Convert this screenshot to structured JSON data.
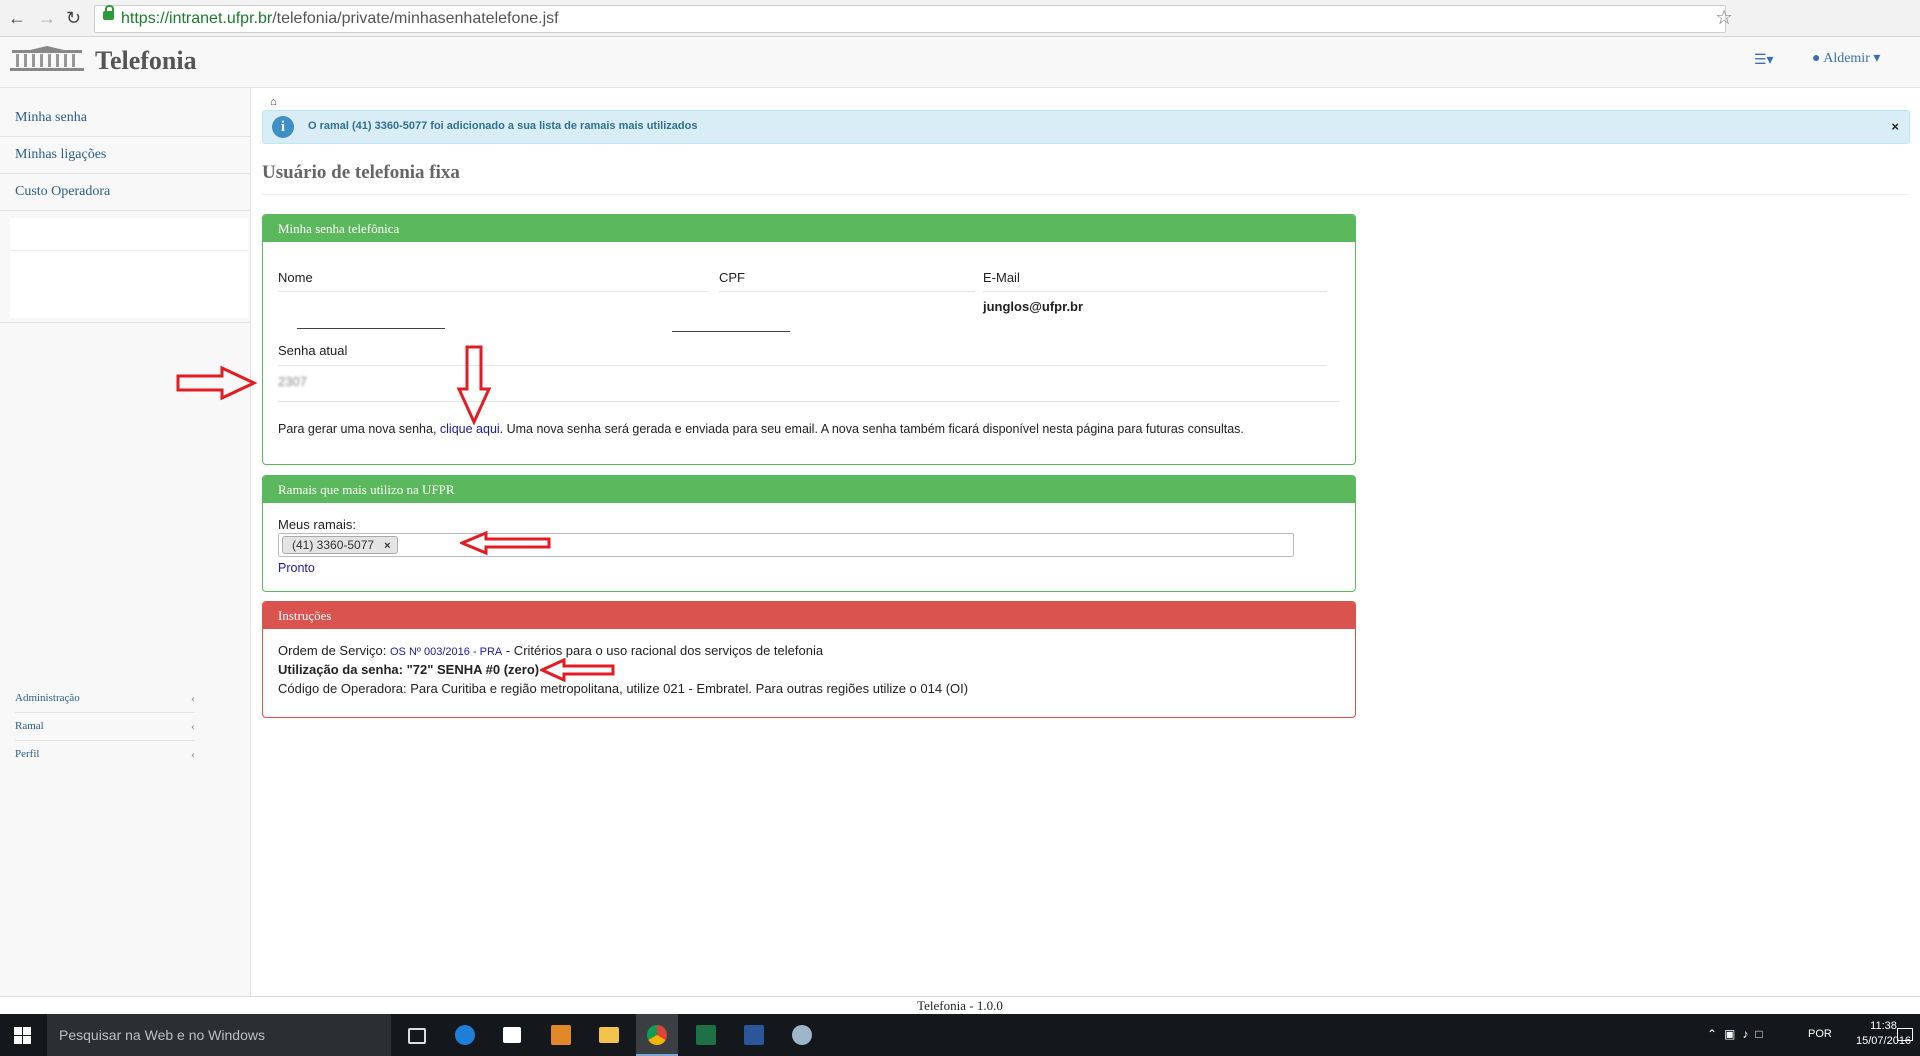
{
  "browser": {
    "url_host": "https://intranet.ufpr.br",
    "url_path": "/telefonia/private/minhasenhatelefone.jsf"
  },
  "header": {
    "app_title": "Telefonia",
    "user_name": "Aldemir"
  },
  "sidebar": {
    "items": [
      {
        "label": "Minha senha"
      },
      {
        "label": "Minhas ligações"
      },
      {
        "label": "Custo Operadora"
      }
    ],
    "sub_items": [
      {
        "label": "Administração"
      },
      {
        "label": "Ramal"
      },
      {
        "label": "Perfil"
      }
    ]
  },
  "alert": {
    "text": "O ramal (41) 3360-5077 foi adicionado a sua lista de ramais mais utilizados",
    "close": "×"
  },
  "page_title": "Usuário de telefonia fixa",
  "panel_senha": {
    "heading": "Minha senha telefônica",
    "nome_label": "Nome",
    "cpf_label": "CPF",
    "email_label": "E-Mail",
    "email_value": "junglos@ufpr.br",
    "senha_label": "Senha atual",
    "senha_value": "2307",
    "gerar_prefix": "Para gerar uma nova senha, ",
    "gerar_link": "clique aqui",
    "gerar_suffix": ". Uma nova senha será gerada e enviada para seu email. A nova senha também ficará disponível nesta página para futuras consultas."
  },
  "panel_ramais": {
    "heading": "Ramais que mais utilizo na UFPR",
    "meus_label": "Meus ramais:",
    "tag": "(41) 3360-5077",
    "tag_remove": "×",
    "pronto": "Pronto"
  },
  "panel_instrucoes": {
    "heading": "Instruções",
    "os_prefix": "Ordem de Serviço: ",
    "os_link": "OS Nº 003/2016 - PRA",
    "os_suffix": " - Critérios para o uso racional dos serviços de telefonia",
    "utilizacao": "Utilização da senha: \"72\" SENHA #0 (zero)",
    "codigo": "Código de Operadora: Para Curitiba e região metropolitana, utilize 021 - Embratel. Para outras regiões utilize o 014 (OI)"
  },
  "footer": "Telefonia - 1.0.0",
  "taskbar": {
    "search_placeholder": "Pesquisar na Web e no Windows",
    "lang": "POR",
    "time": "11:38",
    "date": "15/07/2016"
  },
  "colors": {
    "panel_green": "#5cb85c",
    "panel_red": "#d9534f",
    "alert_bg": "#d9edf7",
    "annotation_arrow": "#e31b23"
  }
}
